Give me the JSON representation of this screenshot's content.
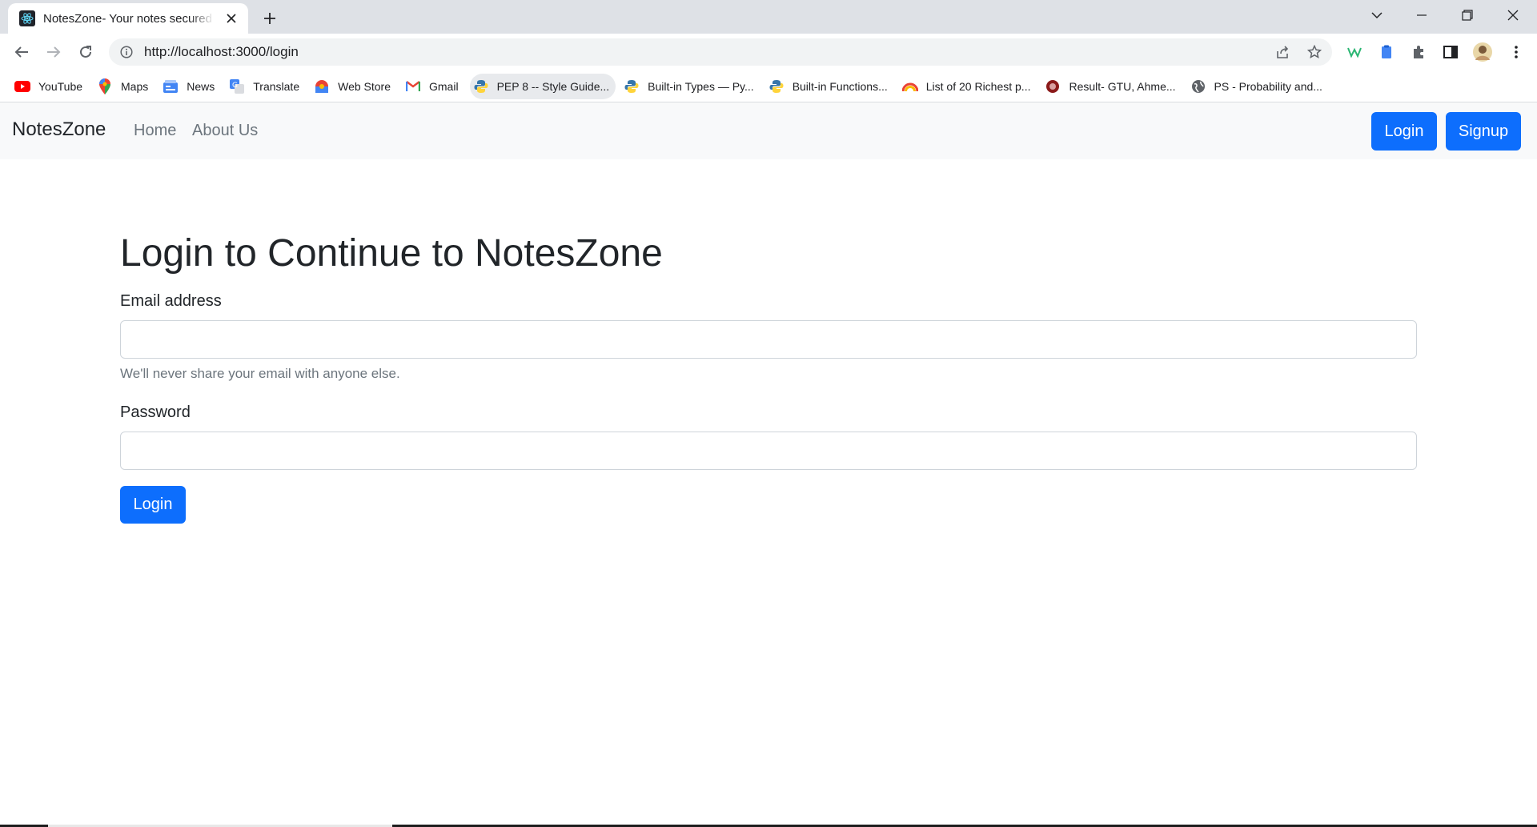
{
  "browser": {
    "tab_title": "NotesZone- Your notes secured in the cloud",
    "url": "http://localhost:3000/login",
    "bookmarks": [
      {
        "label": "YouTube",
        "icon": "youtube-icon",
        "color": "#ff0000"
      },
      {
        "label": "Maps",
        "icon": "maps-pin-icon",
        "color": "#34a853"
      },
      {
        "label": "News",
        "icon": "news-icon",
        "color": "#4285f4"
      },
      {
        "label": "Translate",
        "icon": "translate-icon",
        "color": "#4285f4"
      },
      {
        "label": "Web Store",
        "icon": "web-store-icon",
        "color": "#ea4335"
      },
      {
        "label": "Gmail",
        "icon": "gmail-icon",
        "color": "#ea4335"
      },
      {
        "label": "PEP 8 -- Style Guide...",
        "icon": "python-icon",
        "color": "#3776ab"
      },
      {
        "label": "Built-in Types — Py...",
        "icon": "python-icon",
        "color": "#3776ab"
      },
      {
        "label": "Built-in Functions...",
        "icon": "python-icon",
        "color": "#3776ab"
      },
      {
        "label": "List of 20 Richest p...",
        "icon": "rainbow-icon",
        "color": "#f29900"
      },
      {
        "label": "Result- GTU, Ahme...",
        "icon": "gtu-icon",
        "color": "#8b1a1a"
      },
      {
        "label": "PS - Probability and...",
        "icon": "globe-icon",
        "color": "#5f6368"
      }
    ]
  },
  "navbar": {
    "brand": "NotesZone",
    "links": [
      "Home",
      "About Us"
    ],
    "login_label": "Login",
    "signup_label": "Signup",
    "accent": "#0d6efd"
  },
  "form": {
    "heading": "Login to Continue to NotesZone",
    "email_label": "Email address",
    "email_value": "",
    "email_help": "We'll never share your email with anyone else.",
    "password_label": "Password",
    "password_value": "",
    "submit_label": "Login"
  }
}
